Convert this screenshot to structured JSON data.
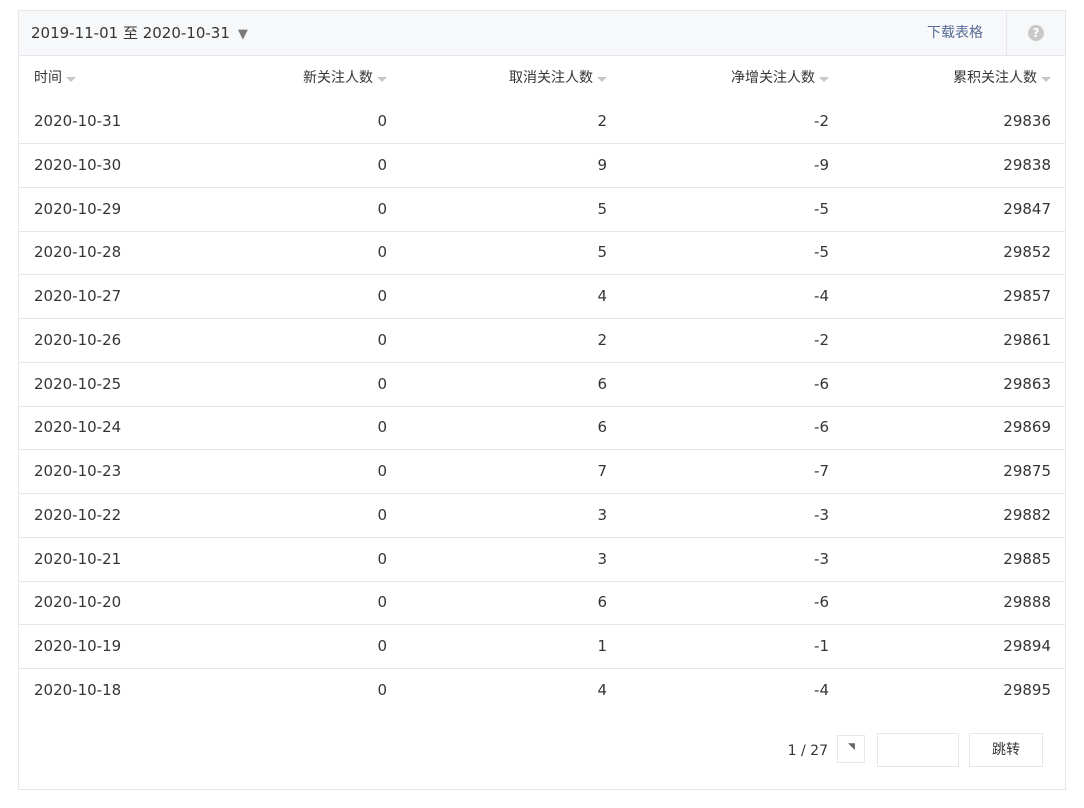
{
  "toolbar": {
    "date_range": "2019-11-01 至 2020-10-31",
    "caret": "▼",
    "download_label": "下载表格",
    "help_glyph": "?"
  },
  "table": {
    "headers": [
      "时间",
      "新关注人数",
      "取消关注人数",
      "净增关注人数",
      "累积关注人数"
    ],
    "rows": [
      [
        "2020-10-31",
        "0",
        "2",
        "-2",
        "29836"
      ],
      [
        "2020-10-30",
        "0",
        "9",
        "-9",
        "29838"
      ],
      [
        "2020-10-29",
        "0",
        "5",
        "-5",
        "29847"
      ],
      [
        "2020-10-28",
        "0",
        "5",
        "-5",
        "29852"
      ],
      [
        "2020-10-27",
        "0",
        "4",
        "-4",
        "29857"
      ],
      [
        "2020-10-26",
        "0",
        "2",
        "-2",
        "29861"
      ],
      [
        "2020-10-25",
        "0",
        "6",
        "-6",
        "29863"
      ],
      [
        "2020-10-24",
        "0",
        "6",
        "-6",
        "29869"
      ],
      [
        "2020-10-23",
        "0",
        "7",
        "-7",
        "29875"
      ],
      [
        "2020-10-22",
        "0",
        "3",
        "-3",
        "29882"
      ],
      [
        "2020-10-21",
        "0",
        "3",
        "-3",
        "29885"
      ],
      [
        "2020-10-20",
        "0",
        "6",
        "-6",
        "29888"
      ],
      [
        "2020-10-19",
        "0",
        "1",
        "-1",
        "29894"
      ],
      [
        "2020-10-18",
        "0",
        "4",
        "-4",
        "29895"
      ]
    ]
  },
  "pager": {
    "page_text": "1 / 27",
    "input_value": "",
    "jump_label": "跳转"
  },
  "colors": {
    "link": "#576b95",
    "border": "#e7e7eb",
    "toolbar_bg": "#f6f8f9",
    "text": "#353535"
  }
}
